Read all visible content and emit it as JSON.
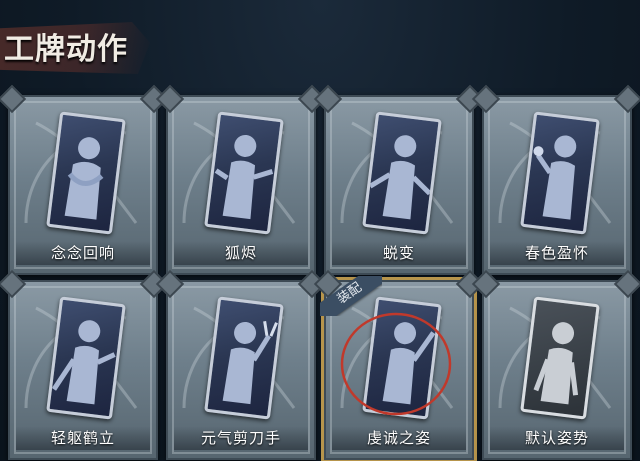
{
  "header": {
    "title": "工牌动作"
  },
  "equipped_badge": "装配",
  "cards": [
    {
      "label": "念念回响",
      "equipped": false,
      "pose": "hug"
    },
    {
      "label": "狐烬",
      "equipped": false,
      "pose": "point"
    },
    {
      "label": "蜕变",
      "equipped": false,
      "pose": "open-arms"
    },
    {
      "label": "春色盈怀",
      "equipped": false,
      "pose": "flower"
    },
    {
      "label": "轻躯鹤立",
      "equipped": false,
      "pose": "crane"
    },
    {
      "label": "元气剪刀手",
      "equipped": false,
      "pose": "peace"
    },
    {
      "label": "虔诚之姿",
      "equipped": true,
      "pose": "wave"
    },
    {
      "label": "默认姿势",
      "equipped": false,
      "pose": "default"
    }
  ],
  "colors": {
    "equip_border": "#b7954c",
    "equip_ring": "#c0392b",
    "header_brush": "#5a2f2a"
  }
}
